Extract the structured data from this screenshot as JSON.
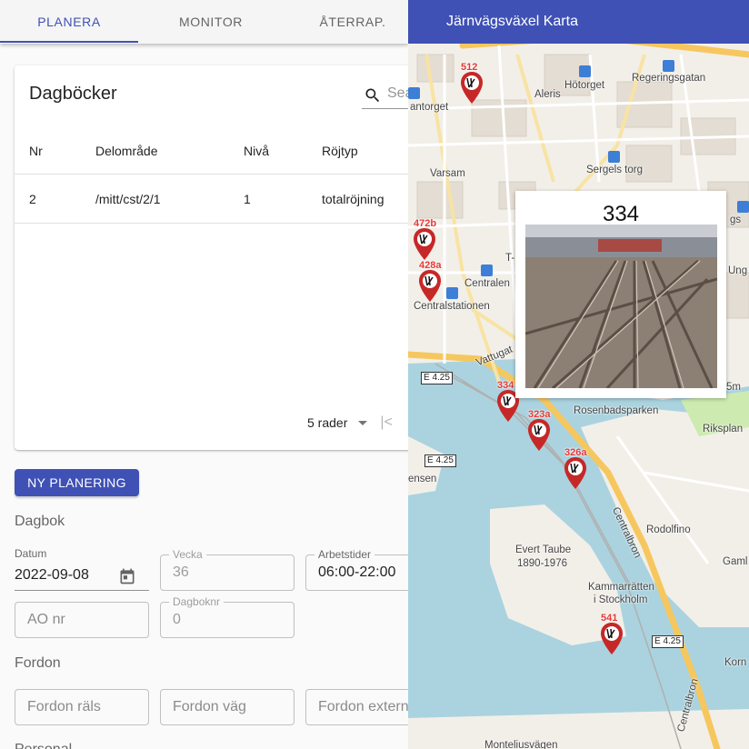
{
  "tabs": [
    {
      "label": "PLANERA",
      "active": true
    },
    {
      "label": "MONITOR",
      "active": false
    },
    {
      "label": "ÅTERRAP.",
      "active": false
    }
  ],
  "diary": {
    "title": "Dagböcker",
    "search_placeholder": "Search",
    "columns": [
      "Nr",
      "Delområde",
      "Nivå",
      "Röjtyp"
    ],
    "rows": [
      [
        "2",
        "/mitt/cst/2/1",
        "1",
        "totalröjning"
      ]
    ],
    "rows_per_page": "5 rader"
  },
  "new_planning_button": "NY PLANERING",
  "sections": {
    "dagbok": "Dagbok",
    "fordon": "Fordon",
    "personal": "Personal"
  },
  "form": {
    "datum_label": "Datum",
    "datum_value": "2022-09-08",
    "vecka_label": "Vecka",
    "vecka_value": "36",
    "arbetstider_label": "Arbetstider",
    "arbetstider_value": "06:00-22:00",
    "ao_placeholder": "AO nr",
    "dagboknr_label": "Dagboknr",
    "dagboknr_value": "0",
    "fordon_rals_placeholder": "Fordon räls",
    "fordon_vag_placeholder": "Fordon väg",
    "fordon_extern_placeholder": "Fordon extern"
  },
  "map": {
    "title": "Järnvägsväxel Karta",
    "popup_title": "334",
    "markers": [
      "512",
      "472b",
      "428a",
      "334",
      "323a",
      "326a",
      "541"
    ],
    "place_labels": {
      "aleris": "Aleris",
      "hotorget": "Hötorget",
      "regeringsgatan": "Regeringsgatan",
      "antorget": "antorget",
      "varsam": "Varsam",
      "sergels_torg": "Sergels torg",
      "centralen": "Centralen",
      "centralstationen": "Centralstationen",
      "rosenbadsparken": "Rosenbadsparken",
      "riksplan": "Riksplan",
      "ensen": "ensen",
      "rodolfino": "Rodolfino",
      "evert_taube": "Evert Taube",
      "evert_taube_years": "1890-1976",
      "kammarratten": "Kammarrätten",
      "i_stockholm": "i Stockholm",
      "gaml": "Gaml",
      "korn": "Korn",
      "montelius": "Monteliusvägen",
      "vattugat": "Vattugat",
      "centralbron_1": "Centralbron",
      "centralbron_2": "Centralbron",
      "t_fragment": "T-",
      "m_fragment": "5m",
      "gs_fragment": "gs",
      "ung_fragment": "Ung"
    },
    "road_shields": [
      "E 4.25",
      "E 4.25",
      "E 4.25"
    ]
  },
  "colors": {
    "primary": "#3f51b5",
    "marker_red": "#c62828",
    "water": "#aad3df",
    "land": "#f2efe9",
    "road_major": "#f6c75e"
  }
}
